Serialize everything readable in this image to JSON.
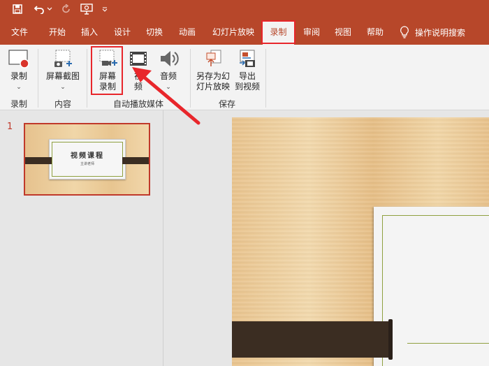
{
  "menu_tabs": [
    "文件",
    "开始",
    "插入",
    "设计",
    "切换",
    "动画",
    "幻灯片放映",
    "录制",
    "审阅",
    "视图",
    "帮助"
  ],
  "active_tab": "录制",
  "search": {
    "label": "操作说明搜索"
  },
  "ribbon": {
    "record": {
      "label": "录制"
    },
    "screenshot": {
      "label": "屏幕截图"
    },
    "screen_recording": {
      "line1": "屏幕",
      "line2": "录制"
    },
    "video": {
      "line1": "视",
      "line2": "频"
    },
    "audio": {
      "label": "音频"
    },
    "save_as_show": {
      "line1": "另存为幻",
      "line2": "灯片放映"
    },
    "export_video": {
      "line1": "导出",
      "line2": "到视频"
    },
    "groups": {
      "record": "录制",
      "content": "内容",
      "autoplay_media": "自动播放媒体",
      "save": "保存"
    }
  },
  "thumbnails": [
    {
      "number": "1",
      "title": "视频课程",
      "subtitle": "主讲老师"
    }
  ],
  "colors": {
    "accent": "#b7472a",
    "highlight": "#e8262b"
  }
}
